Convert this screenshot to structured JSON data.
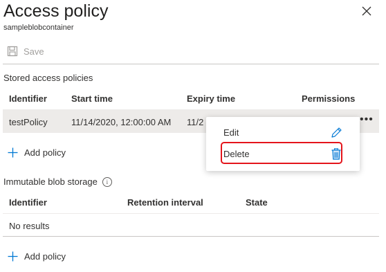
{
  "header": {
    "title": "Access policy",
    "subtitle": "sampleblobcontainer",
    "close_icon": "close-icon"
  },
  "toolbar": {
    "save_label": "Save",
    "save_icon": "save-icon"
  },
  "stored": {
    "section_label": "Stored access policies",
    "columns": [
      "Identifier",
      "Start time",
      "Expiry time",
      "Permissions"
    ],
    "rows": [
      {
        "identifier": "testPolicy",
        "start_time": "11/14/2020, 12:00:00 AM",
        "expiry_time": "11/2",
        "more": "•••"
      }
    ],
    "add_label": "Add policy"
  },
  "context_menu": {
    "items": [
      {
        "label": "Edit",
        "icon": "pencil-icon"
      },
      {
        "label": "Delete",
        "icon": "trash-icon"
      }
    ],
    "highlight_color": "#e4141b"
  },
  "immutable": {
    "section_label": "Immutable blob storage",
    "info_icon": "info-icon",
    "info_glyph": "i",
    "columns": [
      "Identifier",
      "Retention interval",
      "State"
    ],
    "empty_text": "No results",
    "add_label": "Add policy"
  },
  "colors": {
    "accent": "#0078d4",
    "selected_row": "#edebe9",
    "disabled": "#a19f9d"
  }
}
